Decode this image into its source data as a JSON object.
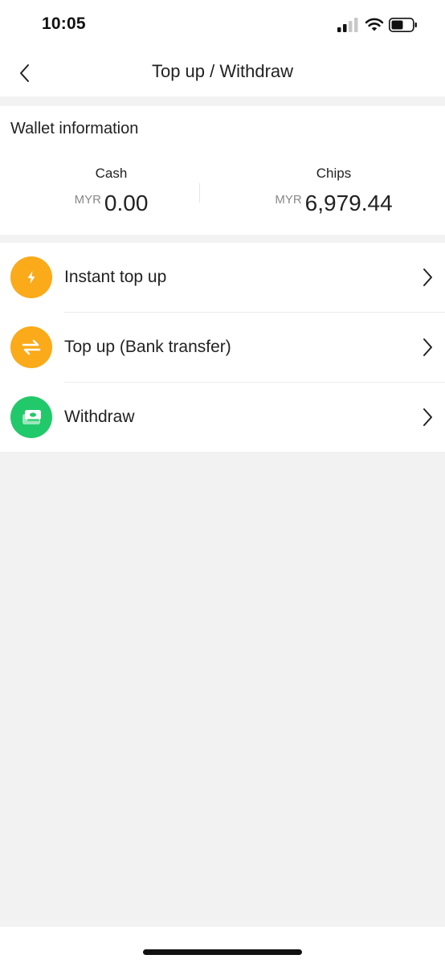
{
  "status_bar": {
    "time": "10:05",
    "icons": [
      "signal-icon",
      "wifi-icon",
      "battery-icon"
    ]
  },
  "nav": {
    "title": "Top up / Withdraw",
    "back_icon": "chevron-left-icon"
  },
  "wallet": {
    "heading": "Wallet information",
    "cash": {
      "label": "Cash",
      "currency": "MYR",
      "value": "0.00"
    },
    "chips": {
      "label": "Chips",
      "currency": "MYR",
      "value": "6,979.44"
    }
  },
  "menu": {
    "items": [
      {
        "label": "Instant top up",
        "icon": "lightning-icon",
        "icon_color": "#FBAA19"
      },
      {
        "label": "Top up (Bank transfer)",
        "icon": "transfer-arrows-icon",
        "icon_color": "#FBAA19"
      },
      {
        "label": "Withdraw",
        "icon": "cash-stack-icon",
        "icon_color": "#22C96A"
      }
    ],
    "chevron_icon": "chevron-right-icon"
  },
  "colors": {
    "background": "#F2F2F3",
    "card": "#FFFFFF",
    "accent_orange": "#FBAA19",
    "accent_green": "#22C96A"
  }
}
